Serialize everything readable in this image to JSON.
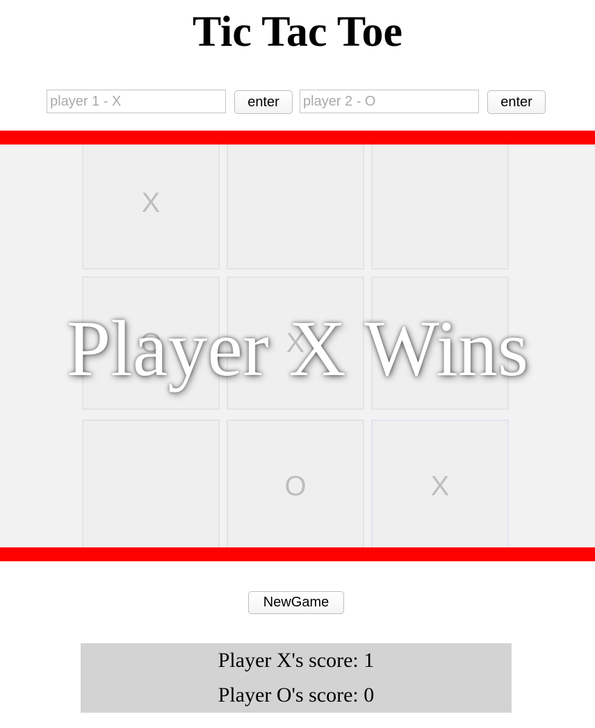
{
  "title": "Tic Tac Toe",
  "player1": {
    "placeholder": "player 1 - X",
    "value": "",
    "enter_label": "enter"
  },
  "player2": {
    "placeholder": "player 2 - O",
    "value": "",
    "enter_label": "enter"
  },
  "board": {
    "cells": [
      "X",
      "",
      "",
      "O",
      "X",
      "",
      "",
      "O",
      "X"
    ]
  },
  "result_message": "Player X Wins",
  "new_game_label": "NewGame",
  "scores": {
    "x": "Player X's score: 1",
    "o": "Player O's score: 0"
  },
  "colors": {
    "bar": "#ff0000",
    "board_bg": "#f2f2f2",
    "score_bg": "#d3d3d3"
  }
}
